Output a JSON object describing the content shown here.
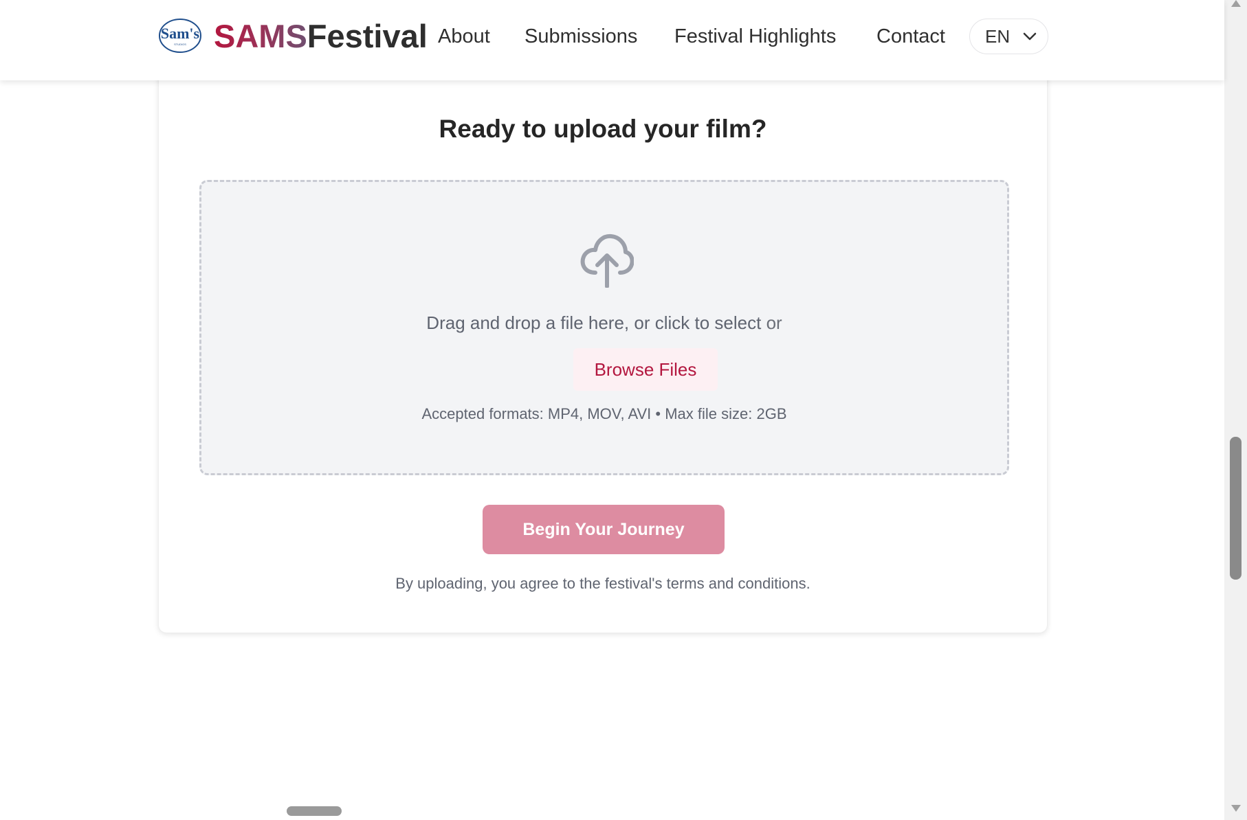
{
  "header": {
    "logo_mark_text": "Sam's",
    "logo_mark_subtext": "STUDIOS",
    "logo_sams": "SAMS",
    "logo_festival": "Festival",
    "nav": [
      "About",
      "Submissions",
      "Festival Highlights",
      "Contact"
    ],
    "language": "EN"
  },
  "upload_card": {
    "title": "Ready to upload your film?",
    "dropzone_text": "Drag and drop a file here, or click to select",
    "dropzone_or": "or",
    "browse_label": "Browse Files",
    "formats_text": "Accepted formats: MP4, MOV, AVI • Max file size: 2GB",
    "submit_label": "Begin Your Journey",
    "terms_text": "By uploading, you agree to the festival's terms and conditions."
  },
  "colors": {
    "brand_red": "#b3173f",
    "submit_pink": "#dd8ca1",
    "dropzone_bg": "#f3f4f6",
    "muted_text": "#5f6470"
  },
  "icons": {
    "upload": "cloud-upload-icon",
    "language_dropdown": "chevron-down-icon"
  }
}
